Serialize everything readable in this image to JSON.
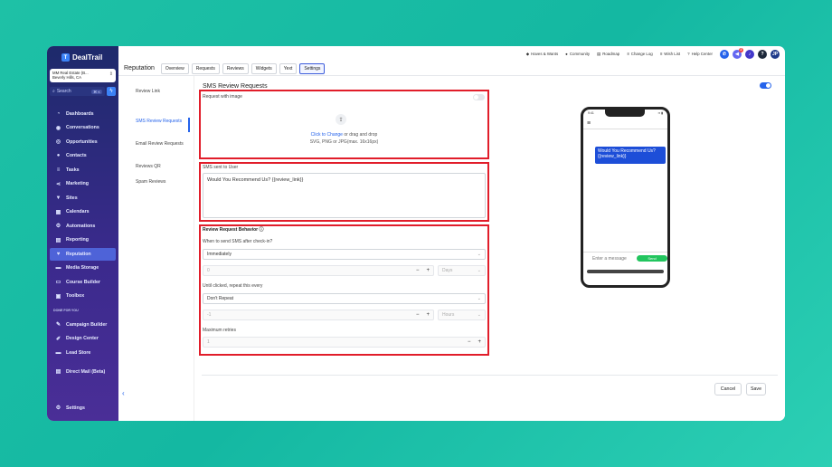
{
  "app": {
    "logo": "DealTrail"
  },
  "location": {
    "name": "MM Real Estate (B...",
    "address": "Beverly Hills, CA"
  },
  "search": {
    "placeholder": "Search",
    "shortcut": "⌘ K"
  },
  "sidebar": {
    "items": [
      {
        "label": "Dashboards",
        "icon": "speedometer-icon"
      },
      {
        "label": "Conversations",
        "icon": "chat-icon"
      },
      {
        "label": "Opportunities",
        "icon": "target-icon"
      },
      {
        "label": "Contacts",
        "icon": "users-icon"
      },
      {
        "label": "Tasks",
        "icon": "list-icon"
      },
      {
        "label": "Marketing",
        "icon": "share-icon"
      },
      {
        "label": "Sites",
        "icon": "filter-icon"
      },
      {
        "label": "Calendars",
        "icon": "calendar-icon"
      },
      {
        "label": "Automations",
        "icon": "cogs-icon"
      },
      {
        "label": "Reporting",
        "icon": "chart-icon"
      },
      {
        "label": "Reputation",
        "icon": "heart-icon",
        "active": true
      },
      {
        "label": "Media Storage",
        "icon": "folder-icon"
      },
      {
        "label": "Course Builder",
        "icon": "screen-icon"
      },
      {
        "label": "Toolbox",
        "icon": "toolbox-icon"
      }
    ],
    "section_label": "DONE FOR YOU",
    "dfy_items": [
      {
        "label": "Campaign Builder",
        "icon": "edit-icon"
      },
      {
        "label": "Design Center",
        "icon": "brush-icon"
      },
      {
        "label": "Lead Store",
        "icon": "store-icon"
      }
    ],
    "direct_mail": "Direct Mail (Beta)",
    "settings": "Settings",
    "collapse": "‹"
  },
  "topnav": {
    "items": [
      "Haves & Wants",
      "Community",
      "Roadmap",
      "Change Log",
      "Wish List",
      "Help Center"
    ],
    "avatar": "JP",
    "notif_count": "2"
  },
  "page": {
    "title": "Reputation",
    "tabs": [
      "Overview",
      "Requests",
      "Reviews",
      "Widgets",
      "Yext",
      "Settings"
    ],
    "active_tab": "Settings"
  },
  "subnav": {
    "items": [
      "Review Link",
      "SMS Review Requests",
      "Email Review Requests",
      "Reviews QR",
      "Spam Reviews"
    ],
    "active": "SMS Review Requests"
  },
  "panel": {
    "title": "SMS Review Requests",
    "image_label": "Request with image",
    "upload_link": "Click to Change",
    "upload_text": " or drag and drop",
    "upload_hint": "SVG, PNG or JPG(max. 16x16px)",
    "sms_label": "SMS sent to User",
    "sms_text": "Would You Recommend Us? {{review_link}}",
    "behavior_label": "Review Request Behavior",
    "when_label": "When to send SMS after check-in?",
    "when_value": "Immediately",
    "delay_value": "0",
    "delay_unit": "Days",
    "repeat_label": "Until clicked, repeat this every",
    "repeat_value": "Don't Repeat",
    "repeat_num": "-1",
    "repeat_unit": "Hours",
    "retries_label": "Maximum retries",
    "retries_value": "1",
    "cancel": "Cancel",
    "save": "Save"
  },
  "preview": {
    "time": "9:41",
    "message": "Would You Recommend Us? {{review_link}}",
    "input_placeholder": "Enter a message",
    "send": "Send"
  },
  "colors": {
    "accent": "#2563eb",
    "highlight": "#e11d2a",
    "send": "#22c55e",
    "sidebar_active": "#4e63d8"
  }
}
